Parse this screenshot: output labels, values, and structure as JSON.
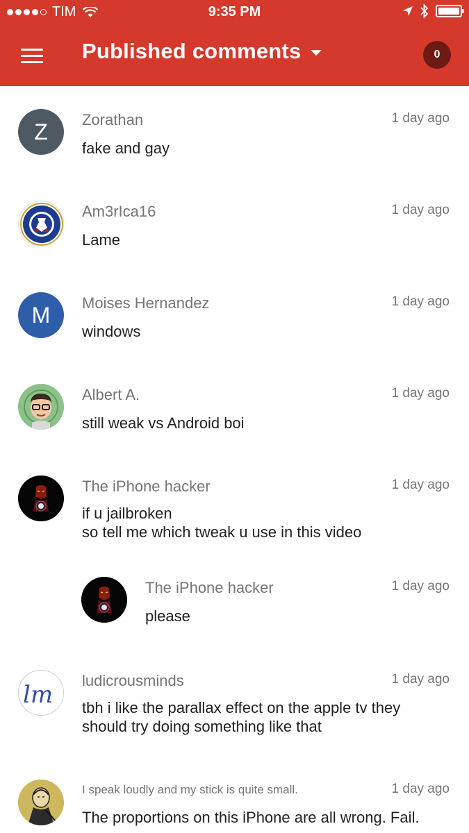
{
  "status_bar": {
    "carrier": "TIM",
    "time": "9:35 PM"
  },
  "app_bar": {
    "title": "Published comments",
    "badge_count": "0",
    "brand_color": "#d5392c"
  },
  "comments": [
    {
      "author": "Zorathan",
      "time": "1 day ago",
      "text": "fake and gay",
      "avatar_letter": "Z",
      "avatar_color": "#4e5a63"
    },
    {
      "author": "Am3rIca16",
      "time": "1 day ago",
      "text": "Lame",
      "avatar_image": "chelsea-crest"
    },
    {
      "author": "Moises Hernandez",
      "time": "1 day ago",
      "text": "windows",
      "avatar_letter": "M",
      "avatar_color": "#2f5ea8"
    },
    {
      "author": "Albert A.",
      "time": "1 day ago",
      "text": "still weak vs Android boi",
      "avatar_image": "cartoon-face"
    },
    {
      "author": "The iPhone hacker",
      "time": "1 day ago",
      "text": "if u jailbroken\nso tell me which tweak u use in this video",
      "avatar_image": "iron-man"
    },
    {
      "author": "The iPhone hacker",
      "time": "1 day ago",
      "text": "please",
      "avatar_image": "iron-man",
      "reply": true
    },
    {
      "author": "ludicrousminds",
      "time": "1 day ago",
      "text": "tbh i like the parallax effect on the apple tv they\nshould try doing something like that",
      "avatar_image": "lm-logo"
    },
    {
      "author": "I speak loudly and my stick is quite small.",
      "time": "1 day ago",
      "text": "The proportions on this iPhone are all wrong. Fail.",
      "avatar_image": "sketch-portrait"
    }
  ]
}
